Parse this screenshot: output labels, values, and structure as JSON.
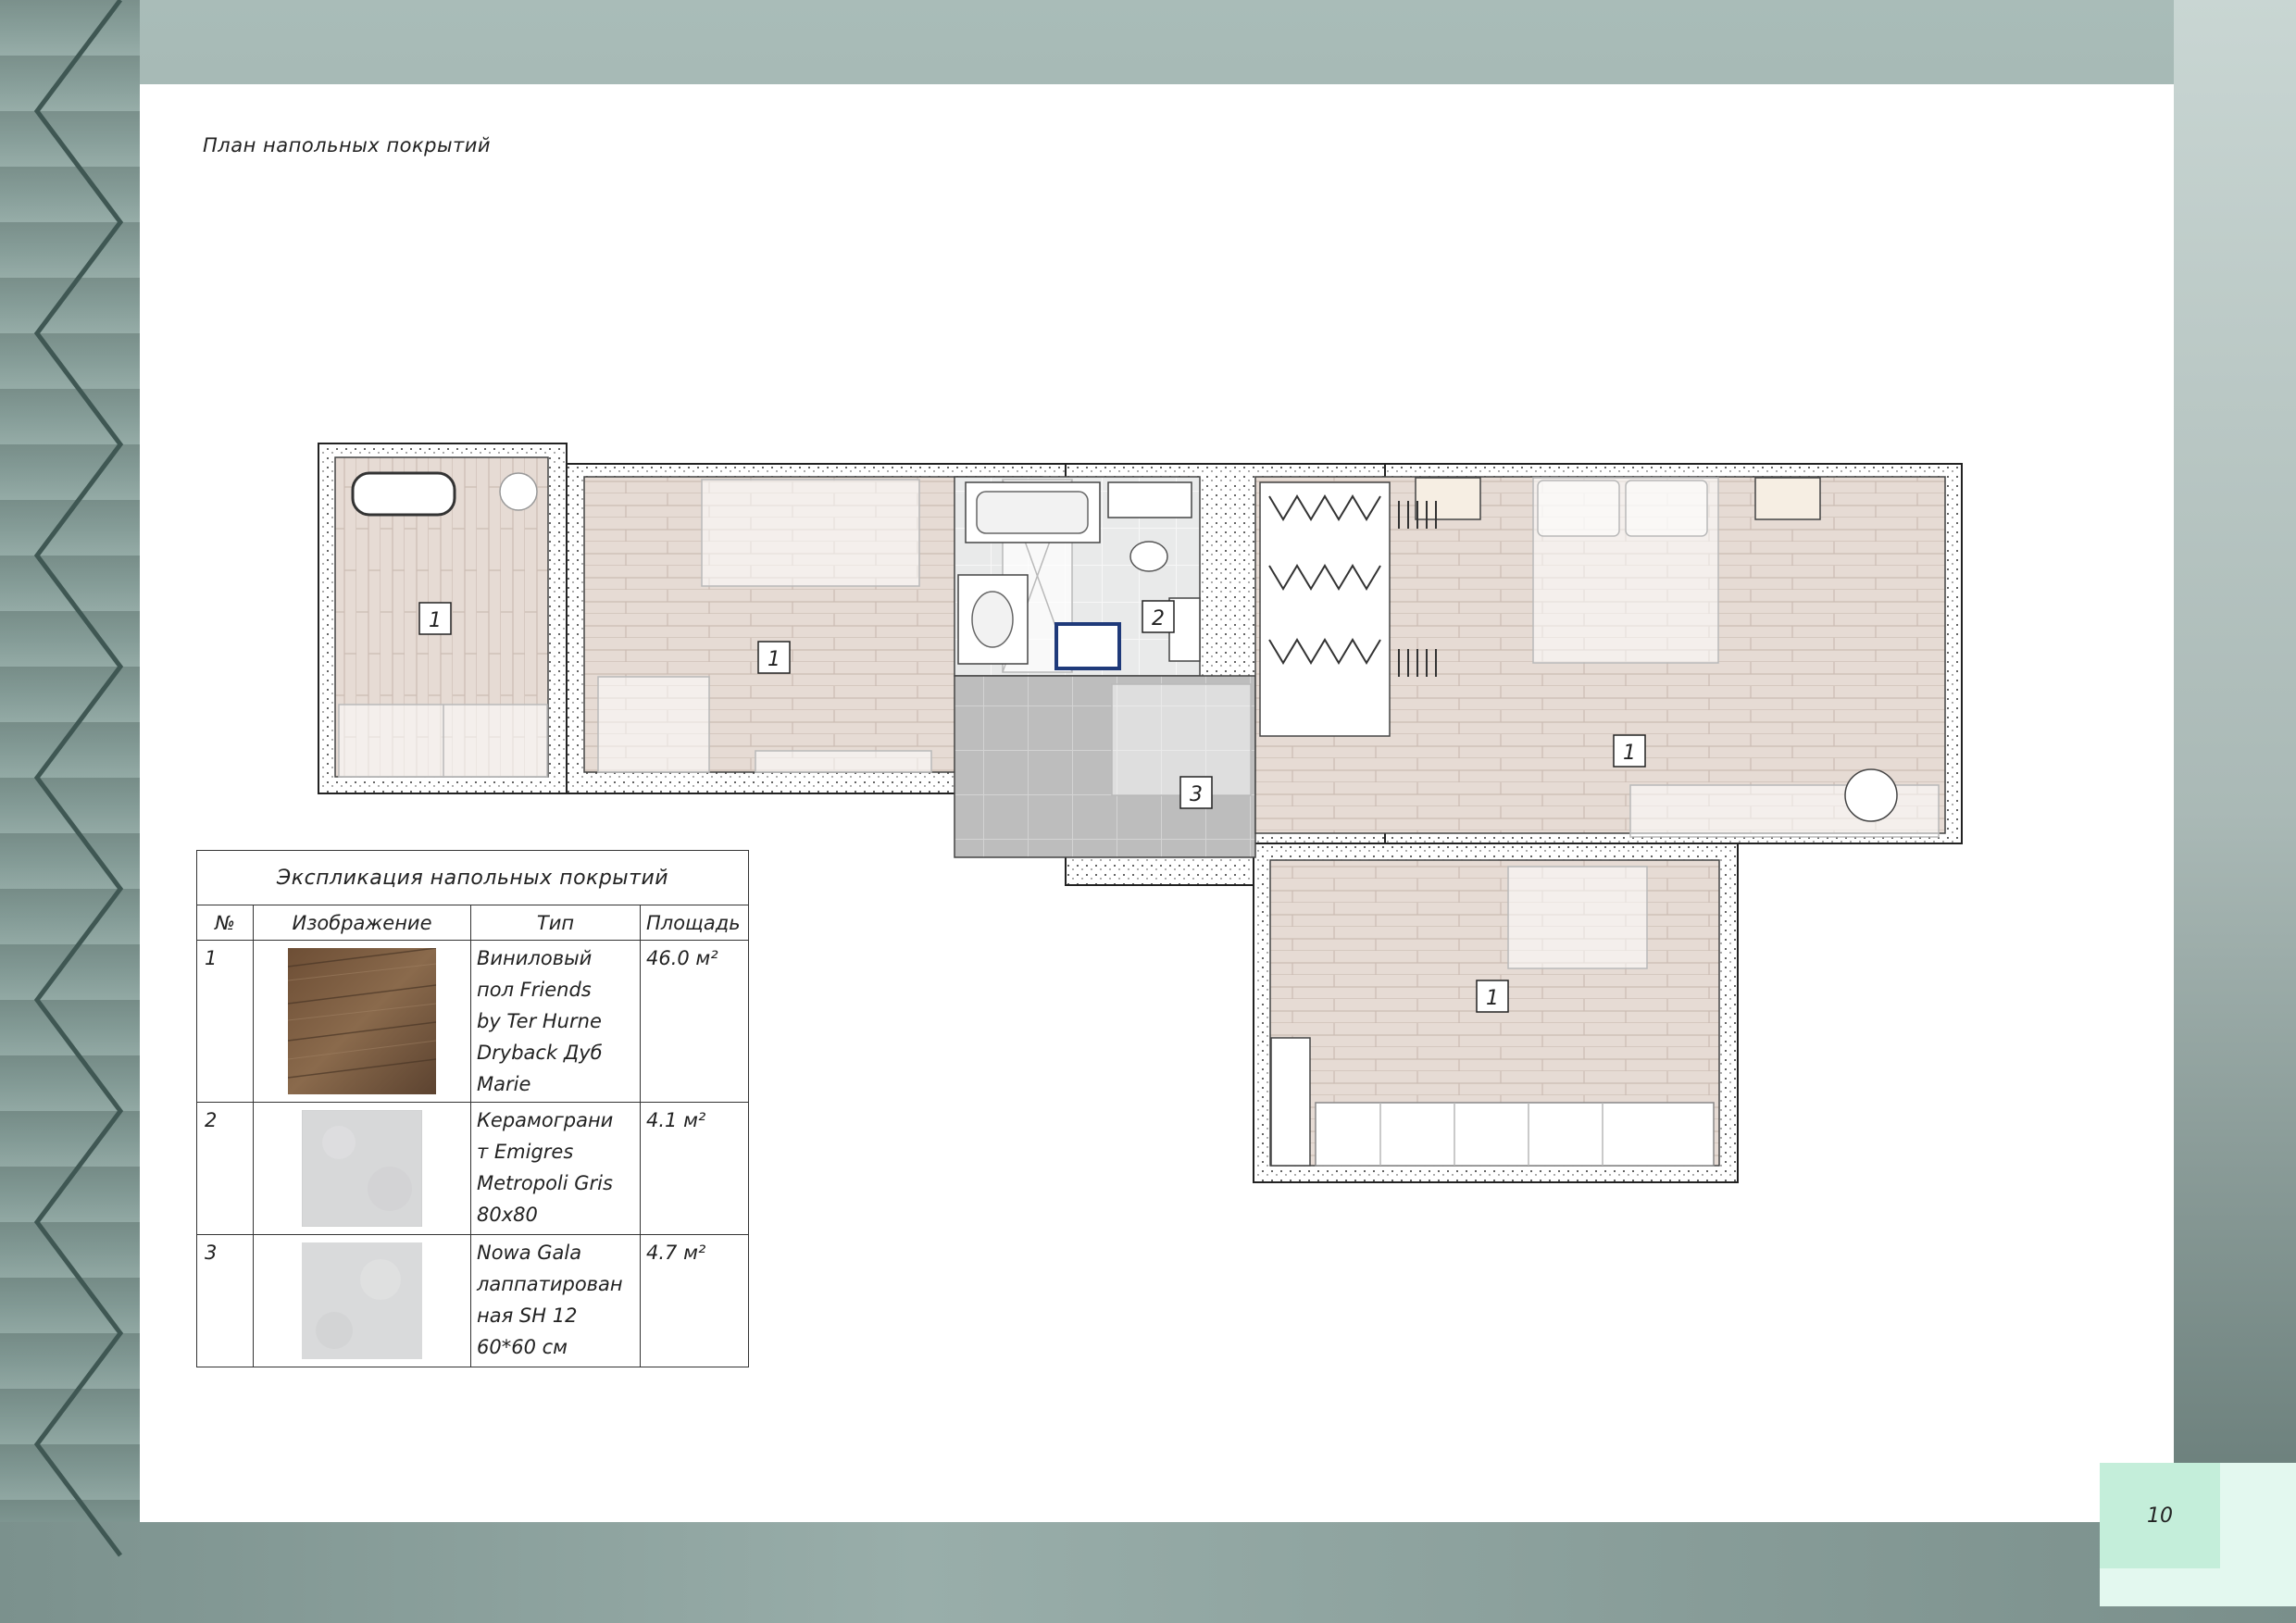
{
  "page": {
    "title": "План напольных покрытий",
    "page_number": "10"
  },
  "plan": {
    "zone_labels": [
      "1",
      "1",
      "2",
      "3",
      "1",
      "1"
    ]
  },
  "legend": {
    "caption": "Экспликация напольных покрытий",
    "headers": [
      "№",
      "Изображение",
      "Тип",
      "Площадь"
    ],
    "rows": [
      {
        "num": "1",
        "type_lines": [
          "Виниловый",
          "пол Friends",
          "by Ter Hurne",
          "Dryback Дуб",
          "Marie"
        ],
        "area": "46.0 м²",
        "swatch": "wood-swatch"
      },
      {
        "num": "2",
        "type_lines": [
          "Керамограни",
          "т Emigres",
          "Metropoli Gris",
          "80x80"
        ],
        "area": "4.1 м²",
        "swatch": "grey-tile-swatch"
      },
      {
        "num": "3",
        "type_lines": [
          "Nowa Gala",
          "лаппатирован",
          "ная SH 12",
          "60*60 см"
        ],
        "area": "4.7 м²",
        "swatch": "grey-tile-swatch"
      }
    ]
  },
  "colors": {
    "wood_floor": "#e6dbd4",
    "tile_floor_2": "#e9eaea",
    "tile_floor_3": "#bdbdbd",
    "accent_page": "#c4eeda",
    "wardrobe_blue": "#1f3a7a"
  }
}
